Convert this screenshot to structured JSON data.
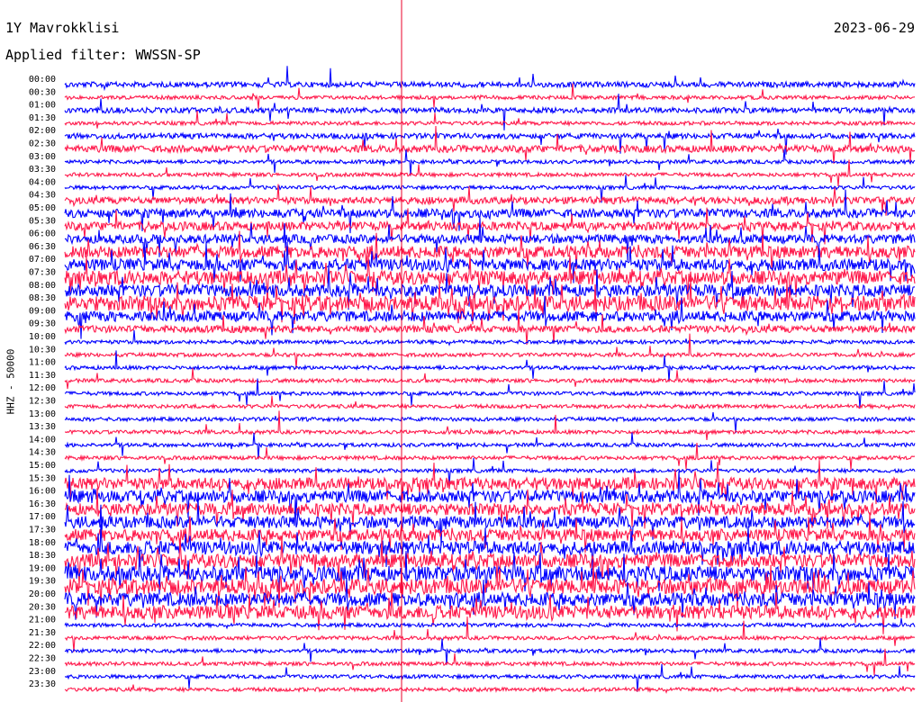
{
  "header": {
    "station": "1Y Mavrokklisi",
    "date": "2023-06-29",
    "filter": "Applied filter: WWSSN-SP"
  },
  "chart_data": {
    "type": "line",
    "title": "1Y Mavrokklisi",
    "ylabel": "HHZ - 50000",
    "colors": [
      "#0000ff",
      "#ff1a4c"
    ],
    "marker_color": "#e8002a",
    "rows": [
      "00:00",
      "00:30",
      "01:00",
      "01:30",
      "02:00",
      "02:30",
      "03:00",
      "03:30",
      "04:00",
      "04:30",
      "05:00",
      "05:30",
      "06:00",
      "06:30",
      "07:00",
      "07:30",
      "08:00",
      "08:30",
      "09:00",
      "09:30",
      "10:00",
      "10:30",
      "11:00",
      "11:30",
      "12:00",
      "12:30",
      "13:00",
      "13:30",
      "14:00",
      "14:30",
      "15:00",
      "15:30",
      "16:00",
      "16:30",
      "17:00",
      "17:30",
      "18:00",
      "18:30",
      "19:00",
      "19:30",
      "20:00",
      "20:30",
      "21:00",
      "21:30",
      "22:00",
      "22:30",
      "23:00",
      "23:30"
    ],
    "activity": [
      2,
      1,
      2,
      1,
      2,
      3,
      1,
      0,
      1,
      3,
      4,
      4,
      4,
      6,
      6,
      7,
      6,
      8,
      5,
      3,
      1,
      1,
      1,
      1,
      1,
      1,
      1,
      1,
      1,
      1,
      1,
      6,
      6,
      6,
      6,
      6,
      7,
      7,
      8,
      8,
      7,
      7,
      1,
      1,
      1,
      1,
      1,
      1
    ]
  }
}
